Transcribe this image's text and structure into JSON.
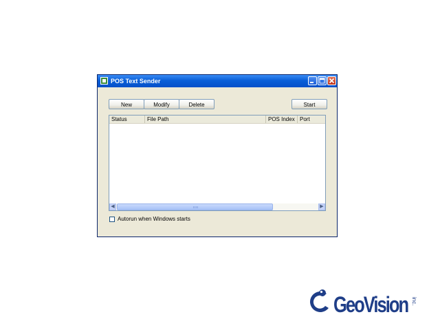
{
  "window": {
    "title": "POS Text Sender",
    "minimize_icon": "minimize-icon",
    "maximize_icon": "maximize-icon",
    "close_icon": "close-icon"
  },
  "toolbar": {
    "new_label": "New",
    "modify_label": "Modify",
    "delete_label": "Delete",
    "start_label": "Start"
  },
  "list": {
    "columns": [
      "Status",
      "File Path",
      "POS Index",
      "Port"
    ],
    "rows": []
  },
  "autorun": {
    "label": "Autorun when Windows starts",
    "checked": false
  },
  "logo": {
    "text": "GeoVision",
    "suffix": "inc."
  },
  "colors": {
    "titlebar": "#0a5fd8",
    "window_bg": "#ece9d8",
    "logo_blue": "#1f3e88"
  }
}
